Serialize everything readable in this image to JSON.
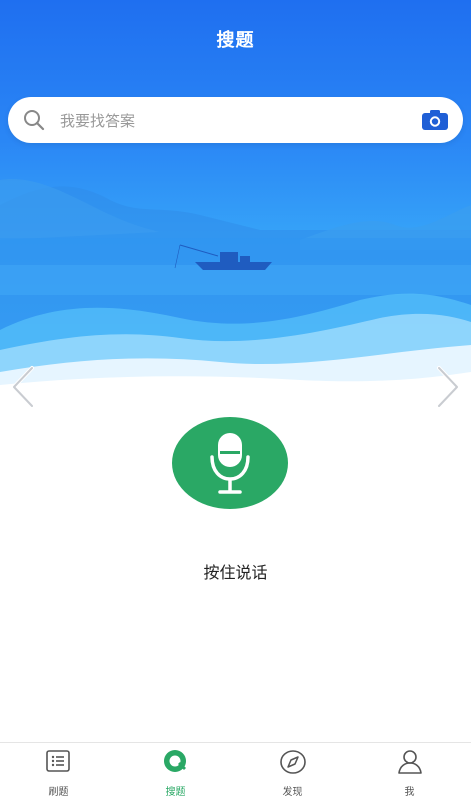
{
  "header": {
    "title": "搜题"
  },
  "search": {
    "placeholder": "我要找答案"
  },
  "voice": {
    "hint": "按住说话"
  },
  "tabs": [
    {
      "label": "刷题",
      "icon": "list-icon",
      "active": false
    },
    {
      "label": "搜题",
      "icon": "search-tab-icon",
      "active": true
    },
    {
      "label": "发现",
      "icon": "compass-icon",
      "active": false
    },
    {
      "label": "我",
      "icon": "user-icon",
      "active": false
    }
  ],
  "colors": {
    "primary": "#1f6ff0",
    "accent": "#2aa865",
    "camera": "#1f5fd6"
  }
}
